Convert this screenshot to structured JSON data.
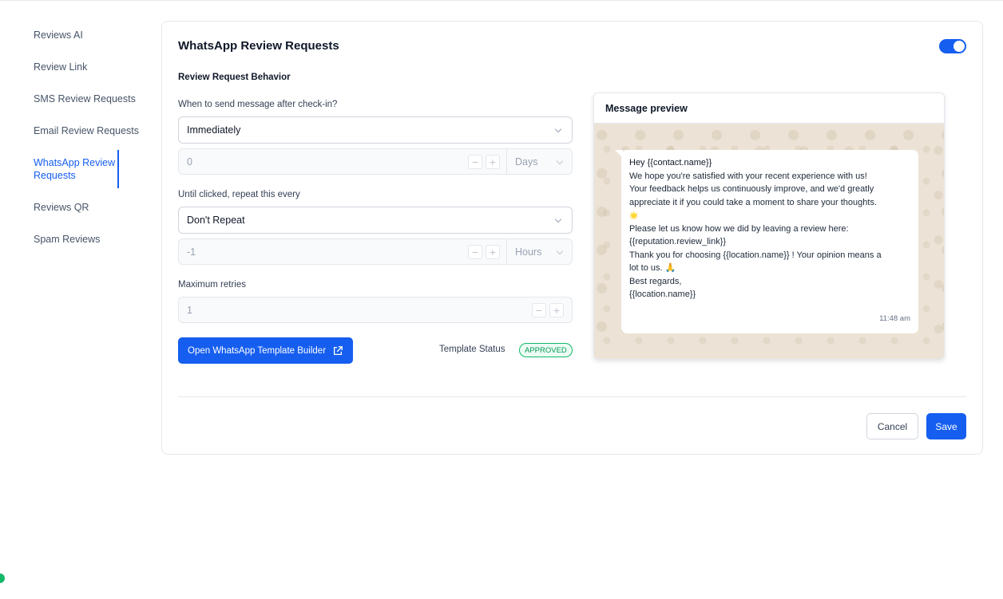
{
  "sidebar": {
    "items": [
      {
        "label": "Reviews AI"
      },
      {
        "label": "Review Link"
      },
      {
        "label": "SMS Review Requests"
      },
      {
        "label": "Email Review Requests"
      },
      {
        "label": "WhatsApp Review Requests",
        "active": true
      },
      {
        "label": "Reviews QR"
      },
      {
        "label": "Spam Reviews"
      }
    ]
  },
  "card": {
    "title": "WhatsApp Review Requests",
    "enabled": true,
    "section_title": "Review Request Behavior",
    "send_after": {
      "label": "When to send message after check-in?",
      "selected": "Immediately",
      "value": "0",
      "unit": "Days"
    },
    "repeat": {
      "label": "Until clicked, repeat this every",
      "selected": "Don't Repeat",
      "value": "-1",
      "unit": "Hours"
    },
    "retries": {
      "label": "Maximum retries",
      "value": "1"
    },
    "template_button": "Open WhatsApp Template Builder",
    "template_status_label": "Template Status",
    "template_status": "APPROVED"
  },
  "preview": {
    "title": "Message preview",
    "lines": [
      "Hey {{contact.name}}",
      "We hope you're satisfied with your recent experience with us!",
      "Your feedback helps us continuously improve, and we'd greatly",
      "appreciate it if you could take a moment to share your thoughts.",
      "🌟",
      "Please let us know how we did by leaving a review here:",
      "{{reputation.review_link}}",
      "Thank you for choosing {{location.name}} ! Your opinion means a",
      "lot to us. 🙏",
      "Best regards,",
      "{{location.name}}"
    ],
    "time": "11:48 am"
  },
  "actions": {
    "cancel": "Cancel",
    "save": "Save"
  },
  "colors": {
    "accent": "#155eef",
    "approved": "#12b76a",
    "chat_bg": "#ece3d6"
  }
}
